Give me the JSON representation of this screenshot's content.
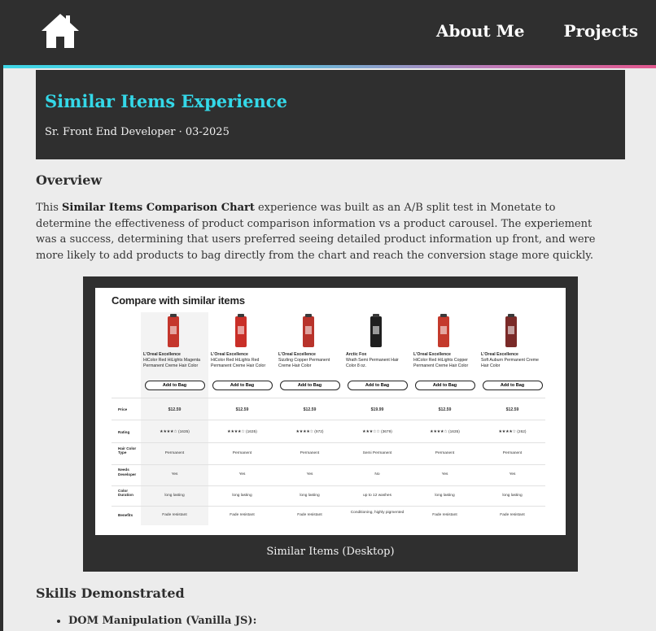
{
  "nav": {
    "home_icon": "home-icon",
    "links": [
      "About Me",
      "Projects"
    ],
    "accent_gradient": [
      "#3fd6e6",
      "#e2588e"
    ]
  },
  "hero": {
    "title": "Similar Items Experience",
    "subtitle": "Sr. Front End Developer · 03-2025",
    "title_color": "#34d8e8"
  },
  "overview": {
    "heading": "Overview",
    "text_before": "This ",
    "bold": "Similar Items Comparison Chart",
    "text_after": " experience was built as an A/B split test in Monetate to determine the effectiveness of product comparison information vs a product carousel. The experiement was a success, determining that users preferred seeing detailed product information up front, and were more likely to add products to bag directly from the chart and reach the conversion stage more quickly."
  },
  "figure": {
    "caption": "Similar Items (Desktop)",
    "screenshot": {
      "title": "Compare with similar items",
      "button_label": "Add to Bag",
      "products": [
        {
          "brand": "L'Oreal Excellence",
          "name": "HiColor Red HiLights Magenta Permanent Creme Hair Color",
          "color": "#c4362c"
        },
        {
          "brand": "L'Oreal Excellence",
          "name": "HiColor Red HiLights Red Permanent Creme Hair Color",
          "color": "#c92f28"
        },
        {
          "brand": "L'Oreal Excellence",
          "name": "Sizzling Copper Permanent Creme Hair Color",
          "color": "#b8332b"
        },
        {
          "brand": "Arctic Fox",
          "name": "Wrath Semi Permanent Hair Color 8 oz.",
          "color": "#1f1f1f"
        },
        {
          "brand": "L'Oreal Excellence",
          "name": "HiColor Red HiLights Copper Permanent Creme Hair Color",
          "color": "#c43a2c"
        },
        {
          "brand": "L'Oreal Excellence",
          "name": "Soft Auburn Permanent Creme Hair Color",
          "color": "#7a2a28"
        }
      ],
      "rows": [
        {
          "label": "Price",
          "values": [
            "$12.59",
            "$12.59",
            "$12.59",
            "$19.99",
            "$12.59",
            "$12.59"
          ]
        },
        {
          "label": "Rating",
          "values": [
            "★★★★☆ (1635)",
            "★★★★☆ (1635)",
            "★★★★☆ (972)",
            "★★★☆☆ (3679)",
            "★★★★☆ (1635)",
            "★★★★☆ (262)"
          ]
        },
        {
          "label": "Hair Color Type",
          "values": [
            "Permanent",
            "Permanent",
            "Permanent",
            "Semi Permanent",
            "Permanent",
            "Permanent"
          ]
        },
        {
          "label": "Needs Developer",
          "values": [
            "Yes",
            "Yes",
            "Yes",
            "No",
            "Yes",
            "Yes"
          ]
        },
        {
          "label": "Color Duration",
          "values": [
            "long lasting",
            "long lasting",
            "long lasting",
            "up to 12 washes",
            "long lasting",
            "long lasting"
          ]
        },
        {
          "label": "Benefits",
          "values": [
            "Fade resistant",
            "Fade resistant",
            "Fade resistant",
            "Conditioning, highly pigmented",
            "Fade resistant",
            "Fade resistant"
          ]
        }
      ]
    }
  },
  "skills": {
    "heading": "Skills Demonstrated",
    "items": [
      "DOM Manipulation (Vanilla JS):"
    ]
  }
}
